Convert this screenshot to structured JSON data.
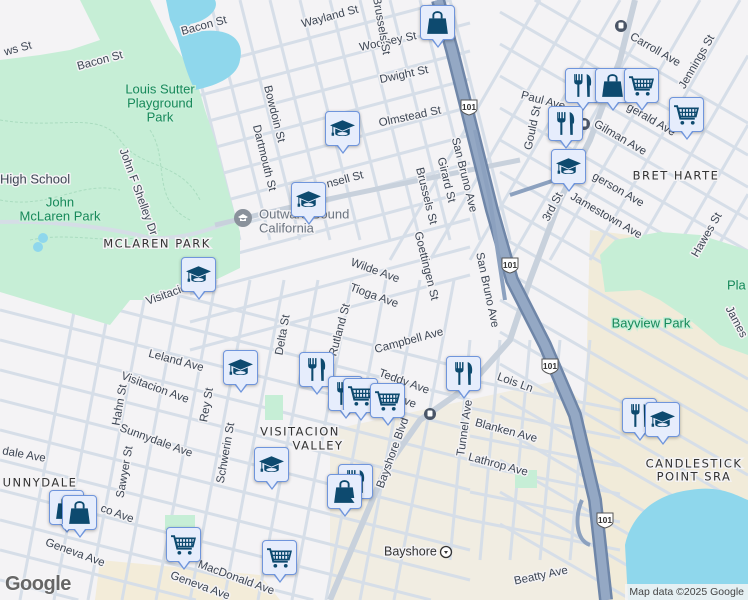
{
  "colors": {
    "land": "#f4f3f5",
    "park": "#c6eed6",
    "water": "#8fd7ec",
    "road": "#d6dee8",
    "highway": "#8ca1bf",
    "marker_fill": "#e6edfc",
    "marker_border": "#6f95dc",
    "icon": "#0d4a6f"
  },
  "streets": [
    "Bacon St",
    "Bacon St",
    "ws St",
    "Wayland St",
    "Woolsey St",
    "Dwight St",
    "Olmstead St",
    "Paul Ave",
    "Gould St",
    "Carroll Ave",
    "Jennings St",
    "Gilman Ave",
    "gerald Ave",
    "gerson Ave",
    "Jamestown Ave",
    "3rd St",
    "Hawes St",
    "James",
    "Bowdoin St",
    "Dartmouth St",
    "Brussels St",
    "Brussels St",
    "Girard St",
    "Goettingen St",
    "San Bruno Ave",
    "San Bruno Ave",
    "nsell St",
    "John F Shelley Dr",
    "Visitacion Ave",
    "Visitacion Ave",
    "Wilde Ave",
    "Tioga Ave",
    "Campbell Ave",
    "Teddy Ave",
    "Lois Ln",
    "Rutland St",
    "Delta St",
    "Leland Ave",
    "Hahn St",
    "Sunnydale Ave",
    "Rey St",
    "Schwerin St",
    "Sawyer St",
    "dale Ave",
    "Geneva Ave",
    "Geneva Ave",
    "MacDonald Ave",
    "co Ave",
    "Bayshore Blvd",
    "Tunnel Ave",
    "Blanken Ave",
    "Lathrop Ave",
    "Beatty Ave",
    "ve"
  ],
  "parks": [
    "Louis Sutter",
    "Playground",
    "Park",
    "John",
    "McLaren Park",
    "Bayview Park",
    "Pla"
  ],
  "areas": [
    "BRET HARTE",
    "MCLAREN PARK",
    "VISITACION",
    "VALLEY",
    "UNNYDALE",
    "CANDLESTICK",
    "POINT SRA"
  ],
  "places": {
    "school_label": "High School",
    "outward_1": "Outward Bound",
    "outward_2": "California",
    "station": "Bayshore"
  },
  "highway_shields": [
    "101",
    "101",
    "101",
    "101"
  ],
  "markers": [
    {
      "category": "shopping"
    },
    {
      "category": "restaurant"
    },
    {
      "category": "shopping"
    },
    {
      "category": "grocery"
    },
    {
      "category": "grocery"
    },
    {
      "category": "restaurant"
    },
    {
      "category": "school"
    },
    {
      "category": "school"
    },
    {
      "category": "school"
    },
    {
      "category": "school"
    },
    {
      "category": "school"
    },
    {
      "category": "restaurant"
    },
    {
      "category": "restaurant"
    },
    {
      "category": "grocery"
    },
    {
      "category": "grocery"
    },
    {
      "category": "restaurant"
    },
    {
      "category": "school"
    },
    {
      "category": "restaurant"
    },
    {
      "category": "shopping"
    },
    {
      "category": "shopping"
    },
    {
      "category": "shopping"
    },
    {
      "category": "grocery"
    },
    {
      "category": "grocery"
    },
    {
      "category": "restaurant"
    },
    {
      "category": "school"
    }
  ],
  "attribution": {
    "logo": "Google",
    "text": "Map data ©2025 Google"
  }
}
